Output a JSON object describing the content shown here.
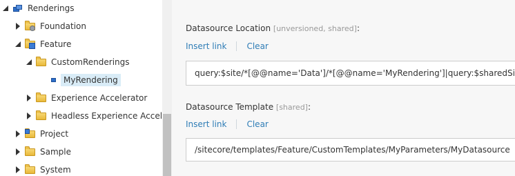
{
  "tree": {
    "items": [
      {
        "label": "Renderings",
        "icon": "renderings-icon",
        "toggle": "expanded"
      },
      {
        "label": "Foundation",
        "icon": "folder-gear-icon",
        "toggle": "collapsed"
      },
      {
        "label": "Feature",
        "icon": "folder-blue-icon",
        "toggle": "expanded"
      },
      {
        "label": "CustomRenderings",
        "icon": "folder-icon",
        "toggle": "expanded"
      },
      {
        "label": "MyRendering",
        "icon": "rendering-icon",
        "toggle": "none"
      },
      {
        "label": "Experience Accelerator",
        "icon": "folder-icon",
        "toggle": "collapsed"
      },
      {
        "label": "Headless Experience Acceler",
        "icon": "folder-icon",
        "toggle": "collapsed"
      },
      {
        "label": "Project",
        "icon": "folder-blue-icon",
        "toggle": "collapsed"
      },
      {
        "label": "Sample",
        "icon": "folder-icon",
        "toggle": "collapsed"
      },
      {
        "label": "System",
        "icon": "folder-icon",
        "toggle": "collapsed"
      }
    ]
  },
  "fields": {
    "datasource_location": {
      "label": "Datasource Location",
      "meta": "[unversioned, shared]",
      "colon": ":",
      "insert_link": "Insert link",
      "clear": "Clear",
      "value": "query:$site/*[@@name='Data']/*[@@name='MyRendering']|query:$sharedSites/*[@@name='Data']/*[@@name='MyRendering']"
    },
    "datasource_template": {
      "label": "Datasource Template",
      "meta": "[shared]",
      "colon": ":",
      "insert_link": "Insert link",
      "clear": "Clear",
      "value": "/sitecore/templates/Feature/CustomTemplates/MyParameters/MyDatasource"
    }
  },
  "colors": {
    "link": "#2f7db6",
    "selection": "#d9ecf7",
    "pane_bg": "#f7f7f7"
  }
}
